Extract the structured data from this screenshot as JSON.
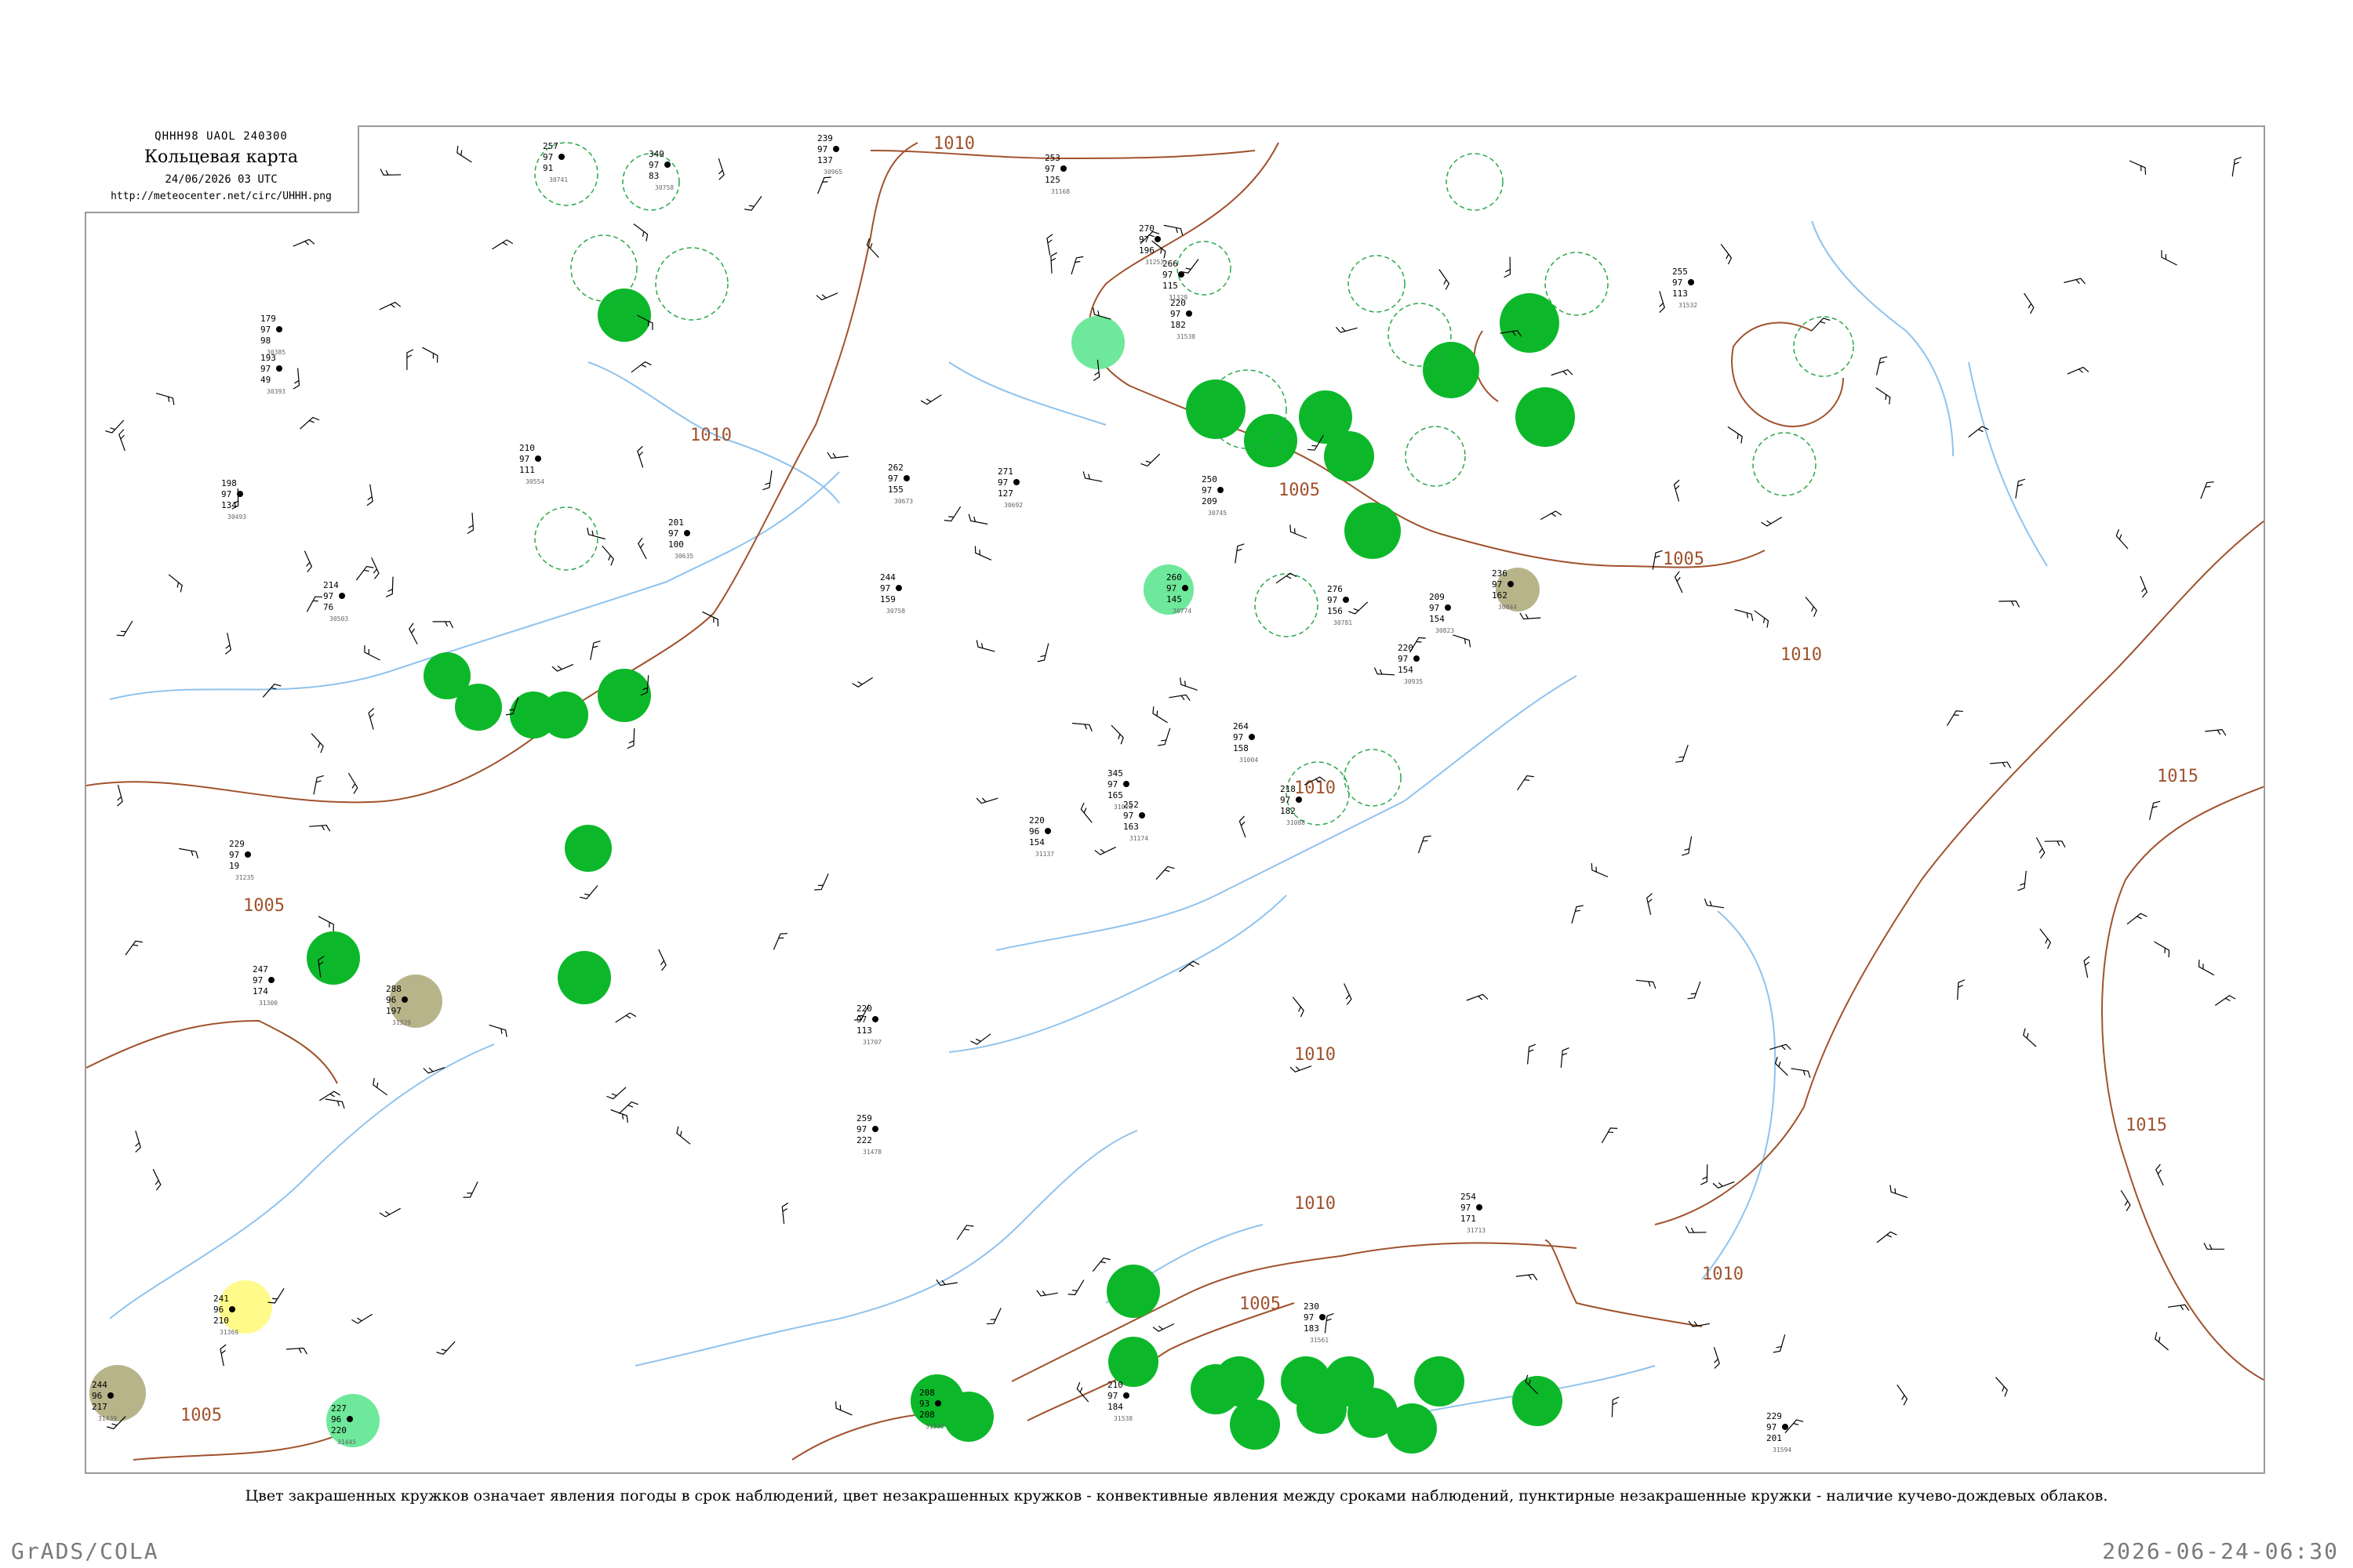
{
  "header": {
    "bulletin": "QHHH98  UAOL  240300",
    "title": "Кольцевая карта",
    "datetime": "24/06/2026 03 UTC",
    "url": "http://meteocenter.net/circ/UHHH.png"
  },
  "caption": "Цвет закрашенных кружков означает явления погоды в срок наблюдений, цвет незакрашенных кружков - конвективные явления между сроками наблюдений, пунктирные незакрашенные кружки - наличие кучево-дождевых облаков.",
  "footer": {
    "left": "GrADS/COLA",
    "right": "2026-06-24-06:30"
  },
  "colors": {
    "rain": "#0cb82a",
    "light_rain": "#6ee89a",
    "fog_haze": "#b8b48a",
    "mist": "#fffa8a",
    "cb_dashed": "#2aa84a",
    "isobar": "#a0522d",
    "river": "#8fc3ee"
  },
  "isobars": [
    {
      "label": "1010"
    },
    {
      "label": "1010"
    },
    {
      "label": "1005"
    },
    {
      "label": "1005"
    },
    {
      "label": "1005"
    },
    {
      "label": "1010"
    },
    {
      "label": "1010"
    },
    {
      "label": "1010"
    },
    {
      "label": "1005"
    },
    {
      "label": "1015"
    },
    {
      "label": "1015"
    },
    {
      "label": "1005"
    },
    {
      "label": "1010"
    },
    {
      "label": "1010"
    }
  ],
  "stations": [
    {
      "p": "257",
      "t": "97",
      "d": "91",
      "id": "30741"
    },
    {
      "p": "349",
      "t": "97",
      "d": "83",
      "id": "30758"
    },
    {
      "p": "239",
      "t": "97",
      "d": "137",
      "id": "30965"
    },
    {
      "p": "253",
      "t": "97",
      "d": "125",
      "id": "31168"
    },
    {
      "p": "270",
      "t": "97",
      "d": "196",
      "id": "31253"
    },
    {
      "p": "266",
      "t": "97",
      "d": "115",
      "id": "31329"
    },
    {
      "p": "255",
      "t": "97",
      "d": "113",
      "id": "31532"
    },
    {
      "p": "220",
      "t": "97",
      "d": "182",
      "id": "31538"
    },
    {
      "p": "179",
      "t": "97",
      "d": "98",
      "id": "30385"
    },
    {
      "p": "193",
      "t": "97",
      "d": "49",
      "id": "30393"
    },
    {
      "p": "198",
      "t": "97",
      "d": "134",
      "id": "30493"
    },
    {
      "p": "214",
      "t": "97",
      "d": "76",
      "id": "30503"
    },
    {
      "p": "210",
      "t": "97",
      "d": "111",
      "id": "30554"
    },
    {
      "p": "201",
      "t": "97",
      "d": "100",
      "id": "30635"
    },
    {
      "p": "262",
      "t": "97",
      "d": "155",
      "id": "30673"
    },
    {
      "p": "271",
      "t": "97",
      "d": "127",
      "id": "30692"
    },
    {
      "p": "250",
      "t": "97",
      "d": "209",
      "id": "30745"
    },
    {
      "p": "244",
      "t": "97",
      "d": "159",
      "id": "30758"
    },
    {
      "p": "260",
      "t": "97",
      "d": "145",
      "id": "30774"
    },
    {
      "p": "276",
      "t": "97",
      "d": "156",
      "id": "30781"
    },
    {
      "p": "209",
      "t": "97",
      "d": "154",
      "id": "30823"
    },
    {
      "p": "236",
      "t": "97",
      "d": "162",
      "id": "30844"
    },
    {
      "p": "220",
      "t": "97",
      "d": "154",
      "id": "30935"
    },
    {
      "p": "264",
      "t": "97",
      "d": "158",
      "id": "31004"
    },
    {
      "p": "345",
      "t": "97",
      "d": "165",
      "id": "31026"
    },
    {
      "p": "218",
      "t": "97",
      "d": "182",
      "id": "31088"
    },
    {
      "p": "220",
      "t": "96",
      "d": "154",
      "id": "31137"
    },
    {
      "p": "252",
      "t": "97",
      "d": "163",
      "id": "31174"
    },
    {
      "p": "229",
      "t": "97",
      "d": "19",
      "id": "31235"
    },
    {
      "p": "247",
      "t": "97",
      "d": "174",
      "id": "31300"
    },
    {
      "p": "288",
      "t": "96",
      "d": "197",
      "id": "31329"
    },
    {
      "p": "241",
      "t": "96",
      "d": "210",
      "id": "31369"
    },
    {
      "p": "244",
      "t": "96",
      "d": "217",
      "id": "31439"
    },
    {
      "p": "227",
      "t": "96",
      "d": "220",
      "id": "31445"
    },
    {
      "p": "259",
      "t": "97",
      "d": "222",
      "id": "31478"
    },
    {
      "p": "208",
      "t": "93",
      "d": "208",
      "id": "31532"
    },
    {
      "p": "210",
      "t": "97",
      "d": "184",
      "id": "31538"
    },
    {
      "p": "230",
      "t": "97",
      "d": "183",
      "id": "31561"
    },
    {
      "p": "229",
      "t": "97",
      "d": "201",
      "id": "31594"
    },
    {
      "p": "220",
      "t": "97",
      "d": "113",
      "id": "31707"
    },
    {
      "p": "254",
      "t": "97",
      "d": "171",
      "id": "31713"
    }
  ]
}
